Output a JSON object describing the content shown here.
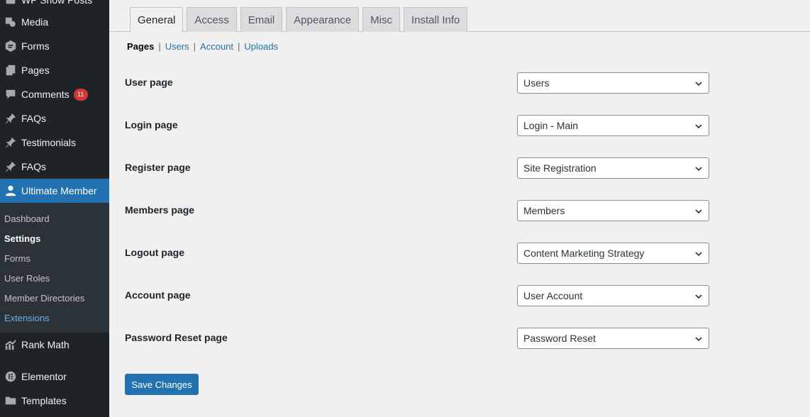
{
  "sidebar": {
    "top_partial": "WP Show Posts",
    "items": [
      {
        "label": "Media",
        "icon": "media-icon"
      },
      {
        "label": "Forms",
        "icon": "forms-icon"
      },
      {
        "label": "Pages",
        "icon": "pages-icon"
      },
      {
        "label": "Comments",
        "icon": "comments-icon",
        "badge": "11"
      },
      {
        "label": "FAQs",
        "icon": "pin-icon"
      },
      {
        "label": "Testimonials",
        "icon": "pin-icon"
      },
      {
        "label": "FAQs",
        "icon": "pin-icon"
      },
      {
        "label": "Ultimate Member",
        "icon": "user-icon"
      },
      {
        "label": "Rank Math",
        "icon": "chart-icon"
      },
      {
        "label": "Elementor",
        "icon": "elementor-icon"
      },
      {
        "label": "Templates",
        "icon": "folder-icon"
      }
    ],
    "submenu": [
      "Dashboard",
      "Settings",
      "Forms",
      "User Roles",
      "Member Directories",
      "Extensions"
    ]
  },
  "tabs": [
    "General",
    "Access",
    "Email",
    "Appearance",
    "Misc",
    "Install Info"
  ],
  "active_tab": "General",
  "subnav": {
    "current": "Pages",
    "links": [
      "Users",
      "Account",
      "Uploads"
    ]
  },
  "fields": [
    {
      "label": "User page",
      "value": "Users"
    },
    {
      "label": "Login page",
      "value": "Login - Main"
    },
    {
      "label": "Register page",
      "value": "Site Registration"
    },
    {
      "label": "Members page",
      "value": "Members"
    },
    {
      "label": "Logout page",
      "value": "Content Marketing Strategy"
    },
    {
      "label": "Account page",
      "value": "User Account"
    },
    {
      "label": "Password Reset page",
      "value": "Password Reset"
    }
  ],
  "save_label": "Save Changes",
  "colors": {
    "sidebar_bg": "#1d2327",
    "accent": "#2271b1",
    "badge": "#d63638",
    "extensions_link": "#72aee6"
  }
}
